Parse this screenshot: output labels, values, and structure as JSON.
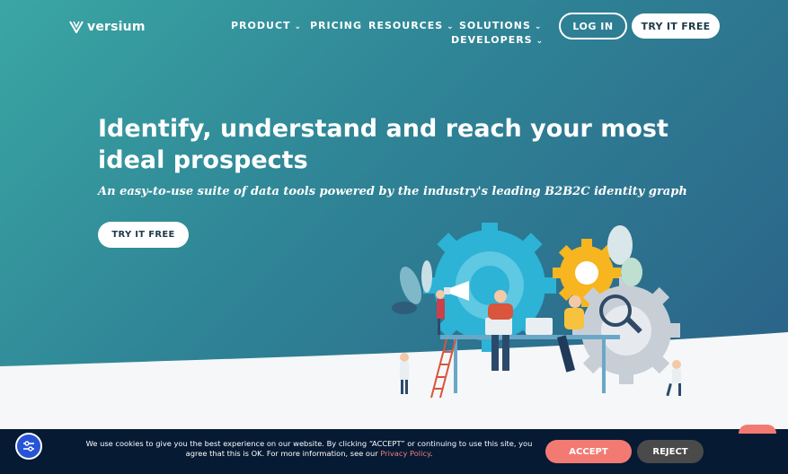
{
  "header": {
    "logo_text": "versium",
    "nav": [
      {
        "label": "PRODUCT",
        "has_dropdown": true
      },
      {
        "label": "PRICING",
        "has_dropdown": false
      },
      {
        "label": "RESOURCES",
        "has_dropdown": true
      },
      {
        "label": "SOLUTIONS",
        "has_dropdown": true
      },
      {
        "label": "DEVELOPERS",
        "has_dropdown": true
      }
    ],
    "login_label": "LOG IN",
    "try_label": "TRY IT FREE"
  },
  "hero": {
    "headline": "Identify, understand and reach your most ideal prospects",
    "subhead": "An easy-to-use suite of data tools powered by the industry's leading B2B2C identity graph",
    "cta_label": "TRY IT FREE"
  },
  "cookie": {
    "text": "We use cookies to give you the best experience on our website. By clicking “ACCEPT” or continuing to use this site, you agree that this is OK. For more information, see our",
    "privacy_link": "Privacy Policy",
    "period": ".",
    "accept_label": "ACCEPT",
    "reject_label": "REJECT"
  },
  "colors": {
    "hero_start": "#3aa6a4",
    "hero_end": "#2a5d86",
    "accept": "#f37a72",
    "reject": "#4a4a4a",
    "cookie_bg": "#061a33"
  },
  "icons": [
    "versium-logo-icon",
    "chevron-down-icon",
    "accessibility-icon",
    "chat-icon"
  ]
}
